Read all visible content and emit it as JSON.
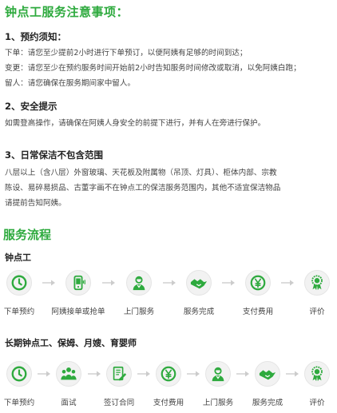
{
  "notice": {
    "title": "钟点工服务注意事项：",
    "sections": [
      {
        "heading": "1、预约须知：",
        "lines": [
          "下单：请您至少提前2小时进行下单预订，以便阿姨有足够的时间到达；",
          "变更：请您至少在预约服务时间开始前2小时告知服务时间修改或取消，以免阿姨白跑；",
          "留人：请您确保在服务期间家中留人。"
        ]
      },
      {
        "heading": "2、安全提示",
        "lines": [
          "如需登高操作，请确保在阿姨人身安全的前提下进行，并有人在旁进行保护。"
        ]
      },
      {
        "heading": "3、日常保洁不包含范围",
        "lines": [
          "八层以上（含八层）外窗玻璃、天花板及附属物（吊顶、灯具）、柜体内部、宗教",
          "陈设、易碎易损品、古董字画不在钟点工的保洁服务范围内，其他不适宜保洁物品",
          "请提前告知阿姨。"
        ]
      }
    ]
  },
  "process": {
    "title": "服务流程",
    "hourly": {
      "title": "钟点工",
      "steps": [
        {
          "label": "下单预约",
          "icon": "clock-icon"
        },
        {
          "label": "阿姨接单或抢单",
          "icon": "phone-icon"
        },
        {
          "label": "上门服务",
          "icon": "worker-icon"
        },
        {
          "label": "服务完成",
          "icon": "handshake-icon"
        },
        {
          "label": "支付费用",
          "icon": "yen-icon"
        },
        {
          "label": "评价",
          "icon": "award-icon"
        }
      ]
    },
    "longterm": {
      "title": "长期钟点工、保姆、月嫂、育婴师",
      "steps": [
        {
          "label": "下单预约",
          "icon": "clock-icon"
        },
        {
          "label": "面试",
          "icon": "people-icon"
        },
        {
          "label": "签订合同",
          "icon": "contract-icon"
        },
        {
          "label": "支付费用",
          "icon": "yen-icon"
        },
        {
          "label": "上门服务",
          "icon": "worker-icon"
        },
        {
          "label": "服务完成",
          "icon": "handshake-icon"
        },
        {
          "label": "评价",
          "icon": "award-icon"
        }
      ]
    }
  },
  "colors": {
    "accent": "#2eaa3e",
    "icon_bg": "#f2f2f2",
    "arrow": "#cccccc"
  }
}
